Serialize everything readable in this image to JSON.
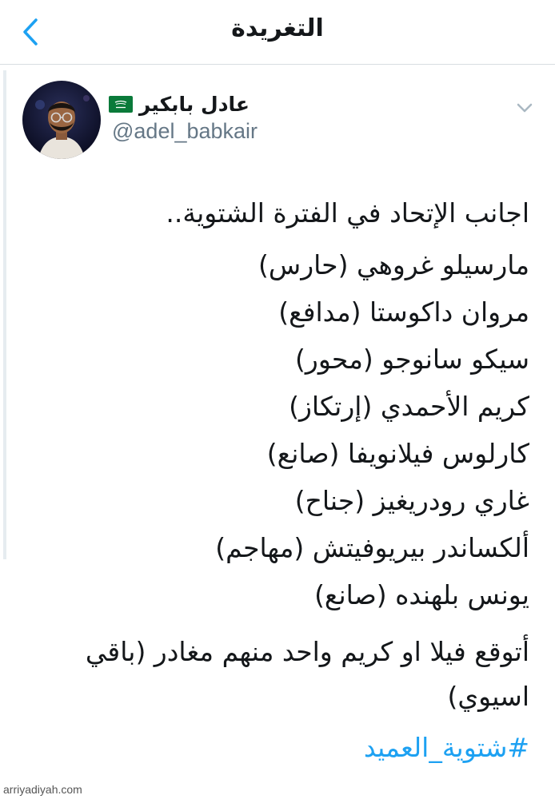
{
  "header": {
    "title": "التغريدة",
    "back_icon": "chevron-left-icon"
  },
  "author": {
    "display_name": "عادل بابكير",
    "handle": "@adel_babkair",
    "flag_icon": "saudi-flag-icon"
  },
  "tweet": {
    "intro": "اجانب الإتحاد في الفترة الشتوية..",
    "players": [
      "مارسيلو غروهي (حارس)",
      "مروان داكوستا (مدافع)",
      "سيكو سانوجو (محور)",
      "كريم الأحمدي (إرتكاز)",
      "كارلوس فيلانويفا (صانع)",
      "غاري رودريغيز (جناح)",
      "ألكساندر بيريوفيتش (مهاجم)",
      "يونس بلهنده (صانع)"
    ],
    "closing": "أتوقع فيلا او كريم واحد منهم مغادر (باقي اسيوي)",
    "hashtag": "#شتوية_العميد"
  },
  "watermark": "arriyadiyah.com",
  "colors": {
    "accent": "#1da1f2",
    "text": "#14171a",
    "secondary": "#657786",
    "divider": "#d8dde1"
  }
}
